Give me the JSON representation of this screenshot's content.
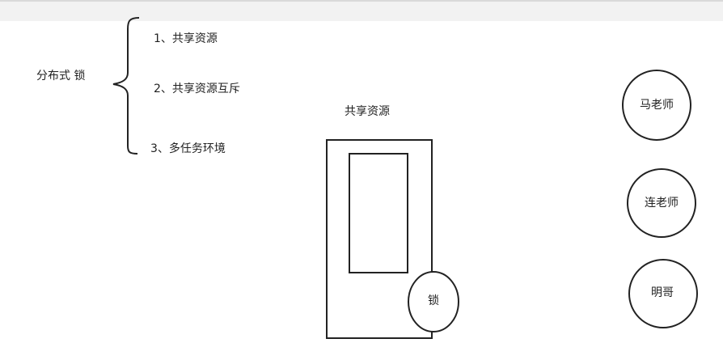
{
  "toolbar": {},
  "diagram": {
    "root_label": "分布式 锁",
    "branches": [
      {
        "label": "1、共享资源"
      },
      {
        "label": "2、共享资源互斥"
      },
      {
        "label": "3、多任务环境"
      }
    ],
    "resource_title": "共享资源",
    "lock_label": "锁",
    "actors": [
      {
        "label": "马老师"
      },
      {
        "label": "连老师"
      },
      {
        "label": "明哥"
      }
    ]
  }
}
